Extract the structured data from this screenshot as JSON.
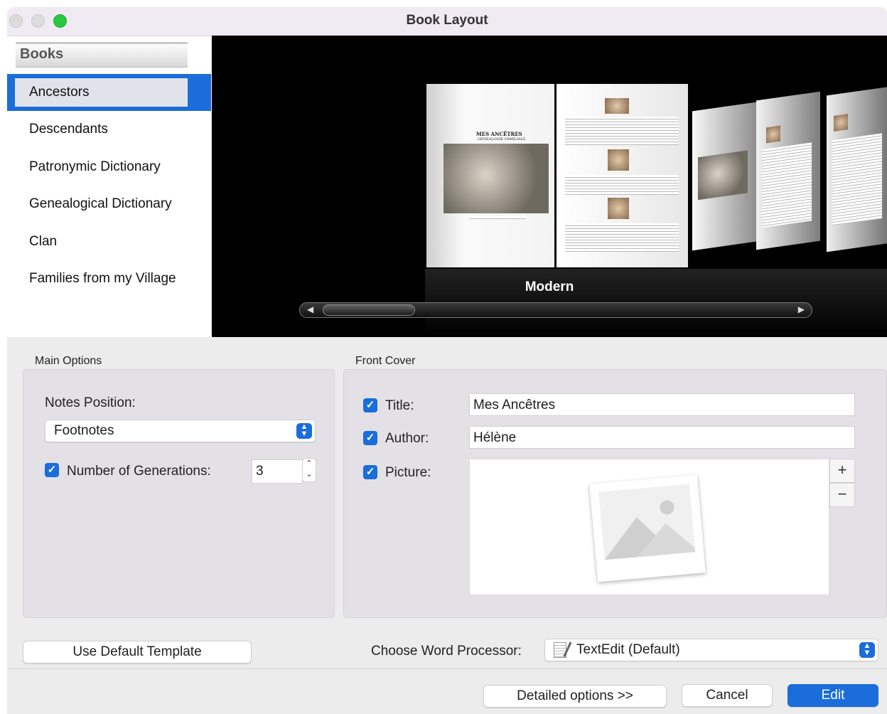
{
  "window": {
    "title": "Book Layout"
  },
  "sidebar": {
    "header": "Books",
    "items": [
      {
        "label": "Ancestors",
        "selected": true
      },
      {
        "label": "Descendants"
      },
      {
        "label": "Patronymic Dictionary"
      },
      {
        "label": "Genealogical Dictionary"
      },
      {
        "label": "Clan"
      },
      {
        "label": "Families from my Village"
      }
    ]
  },
  "preview": {
    "style_name": "Modern",
    "page_title": "MES ANCÊTRES",
    "page_subtitle": "GÉNÉALOGIE FAMILIALE"
  },
  "main_options": {
    "group_label": "Main Options",
    "notes_position_label": "Notes Position:",
    "notes_position_value": "Footnotes",
    "generations_label": "Number of Generations:",
    "generations_checked": true,
    "generations_value": "3"
  },
  "front_cover": {
    "group_label": "Front Cover",
    "title_label": "Title:",
    "title_value": "Mes Ancêtres",
    "title_checked": true,
    "author_label": "Author:",
    "author_value": "Hélène",
    "author_checked": true,
    "picture_label": "Picture:",
    "picture_checked": true,
    "add_symbol": "+",
    "remove_symbol": "−"
  },
  "bottom": {
    "default_template_button": "Use Default Template",
    "word_processor_label": "Choose Word Processor:",
    "word_processor_value": "TextEdit (Default)",
    "detailed_button": "Detailed options >>",
    "cancel_button": "Cancel",
    "edit_button": "Edit"
  },
  "colors": {
    "accent": "#1a6ddb",
    "preview_bg": "#000000"
  }
}
